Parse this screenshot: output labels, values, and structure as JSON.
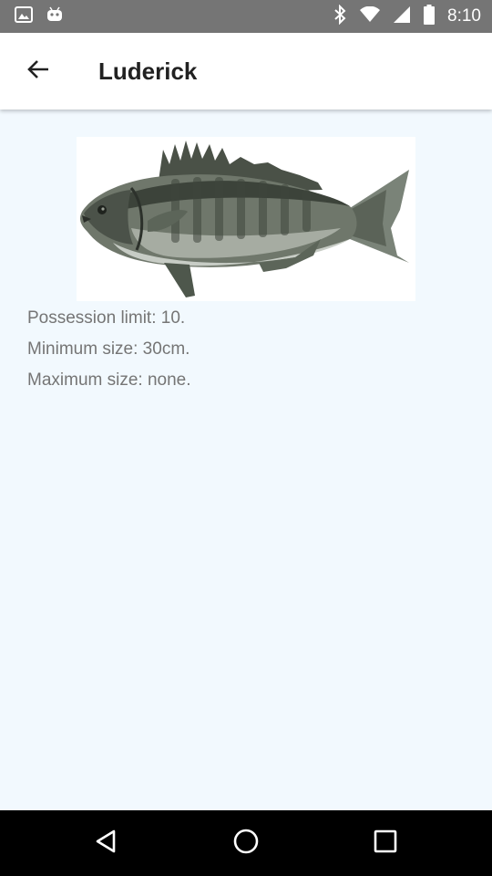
{
  "status_bar": {
    "time": "8:10",
    "icons": [
      "gallery-icon",
      "android-icon",
      "bluetooth-icon",
      "wifi-icon",
      "signal-icon",
      "battery-icon"
    ]
  },
  "app_bar": {
    "title": "Luderick",
    "back_icon": "arrow-back-icon"
  },
  "fish": {
    "image_subject": "luderick fish"
  },
  "info": {
    "possession_limit": "Possession limit: 10.",
    "minimum_size": "Minimum size: 30cm.",
    "maximum_size": "Maximum size: none."
  },
  "nav_bar": {
    "icons": [
      "back-triangle-icon",
      "home-circle-icon",
      "recents-square-icon"
    ]
  },
  "colors": {
    "status_bar": "#757575",
    "app_bar": "#ffffff",
    "content_background": "#f2f9fe",
    "info_text": "#757575",
    "nav_bar": "#000000"
  }
}
